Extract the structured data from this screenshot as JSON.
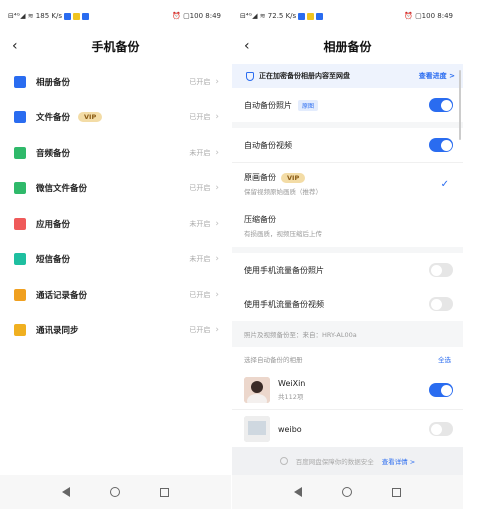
{
  "left": {
    "status": {
      "left": "⊟⁴ᴳ◢ ≋ 185 K/s",
      "time": "⏰ ▢100 8:49"
    },
    "header": {
      "back": "‹",
      "title": "手机备份"
    },
    "items": [
      {
        "label": "相册备份",
        "vip": "",
        "status": "已开启",
        "color": "#2a6cf0",
        "icon": "photo-icon"
      },
      {
        "label": "文件备份",
        "vip": "VIP",
        "status": "已开启",
        "color": "#2a6cf0",
        "icon": "file-icon"
      },
      {
        "label": "音频备份",
        "vip": "",
        "status": "未开启",
        "color": "#2fb96a",
        "icon": "music-icon"
      },
      {
        "label": "微信文件备份",
        "vip": "",
        "status": "已开启",
        "color": "#2fb96a",
        "icon": "wechat-icon"
      },
      {
        "label": "应用备份",
        "vip": "",
        "status": "未开启",
        "color": "#ef5a5a",
        "icon": "app-icon"
      },
      {
        "label": "短信备份",
        "vip": "",
        "status": "未开启",
        "color": "#1fbfa0",
        "icon": "sms-icon"
      },
      {
        "label": "通话记录备份",
        "vip": "",
        "status": "已开启",
        "color": "#f0a020",
        "icon": "phone-icon"
      },
      {
        "label": "通讯录同步",
        "vip": "",
        "status": "已开启",
        "color": "#f0b020",
        "icon": "contacts-icon"
      }
    ]
  },
  "right": {
    "status": {
      "left": "⊟⁴ᴳ◢ ≋ 72.5 K/s",
      "time": "⏰ ▢100 8:49"
    },
    "header": {
      "back": "‹",
      "title": "相册备份"
    },
    "banner": {
      "text": "正在加密备份相册内容至网盘",
      "link": "查看进度 >"
    },
    "auto_photo": {
      "label": "自动备份照片",
      "tag": "原图"
    },
    "auto_video": {
      "label": "自动备份视频"
    },
    "original": {
      "label": "原画备份",
      "vip": "VIP",
      "sub": "保留视频原始画质（推荐）",
      "check": "✓"
    },
    "compress": {
      "label": "压缩备份",
      "sub": "有损画质，视频压缩后上传"
    },
    "mobile_photo": {
      "label": "使用手机流量备份照片"
    },
    "mobile_video": {
      "label": "使用手机流量备份视频"
    },
    "device": "照片及视频备份至：来自：HRY-AL00a",
    "albums_header": {
      "label": "选择自动备份的相册",
      "all": "全选"
    },
    "albums": [
      {
        "name": "WeiXin",
        "count": "共112项"
      },
      {
        "name": "weibo",
        "count": ""
      }
    ],
    "footer": {
      "text": "百度网盘保障你的数据安全",
      "link": "查看详情 >"
    }
  },
  "navbar": {
    "back": "◁",
    "home": "○",
    "recent": "□"
  }
}
